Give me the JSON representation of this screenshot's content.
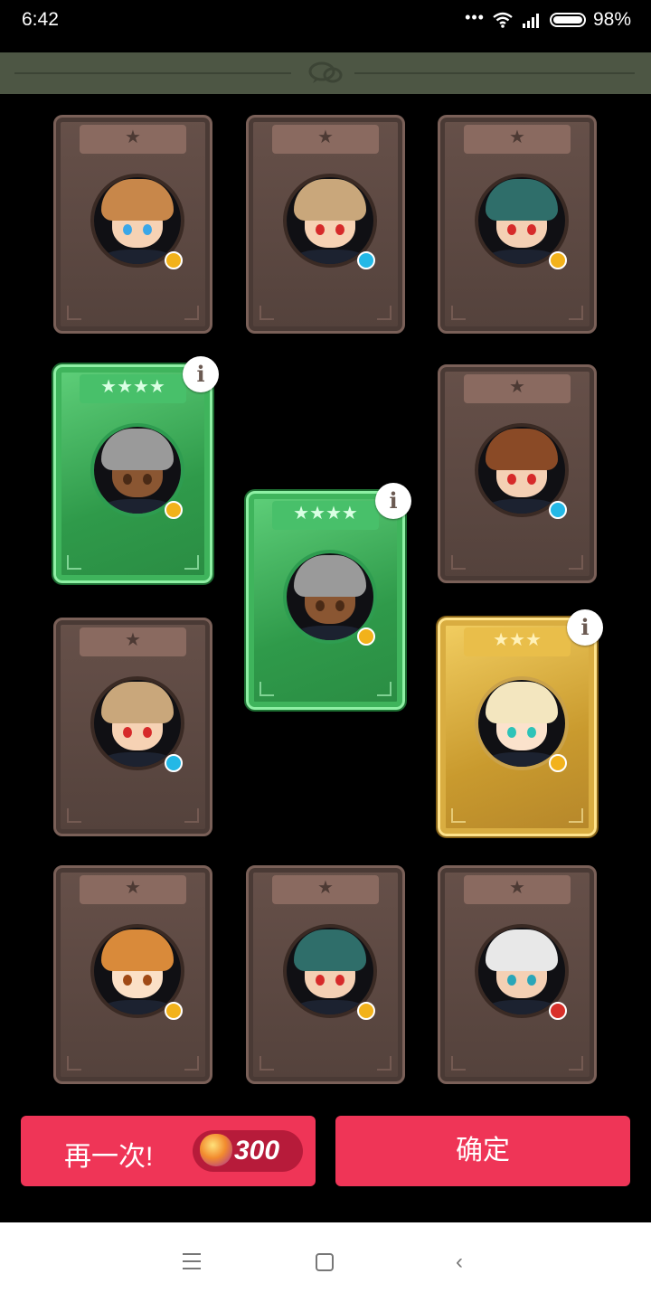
{
  "status_bar": {
    "time": "6:42",
    "signal_dots": "•••",
    "battery_percent": "98%"
  },
  "cards": [
    {
      "row": 1,
      "col": 1,
      "rarity": "common",
      "stars": "★",
      "hair": "#c8874a",
      "skin": "#f6d2b4",
      "eye": "#3aa7e8",
      "type": "hand",
      "type_color": "#f2b21b",
      "info": false
    },
    {
      "row": 1,
      "col": 2,
      "rarity": "common",
      "stars": "★",
      "hair": "#c9a77b",
      "skin": "#f6d2b4",
      "eye": "#d62a2a",
      "type": "bubble",
      "type_color": "#23b8e6",
      "info": false
    },
    {
      "row": 1,
      "col": 3,
      "rarity": "common",
      "stars": "★",
      "hair": "#2f6e6a",
      "skin": "#f4d0b4",
      "eye": "#d62a2a",
      "type": "hand",
      "type_color": "#f2b21b",
      "info": false
    },
    {
      "row": 2,
      "col": 1,
      "rarity": "epic",
      "stars": "★★★★",
      "hair": "#9a9a9a",
      "skin": "#8a5632",
      "eye": "#4a2a16",
      "type": "hand",
      "type_color": "#f2b21b",
      "info": true,
      "info_label": "i"
    },
    {
      "row": 2,
      "col": 3,
      "rarity": "common",
      "stars": "★",
      "hair": "#8a4a26",
      "skin": "#f4d0b4",
      "eye": "#d62a2a",
      "type": "bubble",
      "type_color": "#23b8e6",
      "info": false
    },
    {
      "row": 2.5,
      "col": 2,
      "rarity": "epic",
      "stars": "★★★★",
      "hair": "#9a9a9a",
      "skin": "#8a5632",
      "eye": "#4a2a16",
      "type": "hand",
      "type_color": "#f2b21b",
      "info": true,
      "info_label": "i"
    },
    {
      "row": 3,
      "col": 1,
      "rarity": "common",
      "stars": "★",
      "hair": "#c9a77b",
      "skin": "#f6d2b4",
      "eye": "#d62a2a",
      "type": "bubble",
      "type_color": "#23b8e6",
      "info": false
    },
    {
      "row": 3,
      "col": 3,
      "rarity": "rare",
      "stars": "★★★",
      "hair": "#f3e6bf",
      "skin": "#fbe2cc",
      "eye": "#2ec3b8",
      "type": "hand",
      "type_color": "#f2b21b",
      "info": true,
      "info_label": "i"
    },
    {
      "row": 4,
      "col": 1,
      "rarity": "common",
      "stars": "★",
      "hair": "#d98a3a",
      "skin": "#fbe0c6",
      "eye": "#a04a16",
      "type": "hand",
      "type_color": "#f2b21b",
      "info": false
    },
    {
      "row": 4,
      "col": 2,
      "rarity": "common",
      "stars": "★",
      "hair": "#2f6e6a",
      "skin": "#f4d0b4",
      "eye": "#d62a2a",
      "type": "hand",
      "type_color": "#f2b21b",
      "info": false
    },
    {
      "row": 4,
      "col": 3,
      "rarity": "common",
      "stars": "★",
      "hair": "#e8e8e8",
      "skin": "#f4d0b4",
      "eye": "#2aa6b8",
      "type": "rabbit",
      "type_color": "#d8302a",
      "info": false
    }
  ],
  "buttons": {
    "again_label": "再一次!",
    "again_cost": "300",
    "again_currency_icon": "gem-icon",
    "confirm_label": "确定"
  },
  "colors": {
    "button": "#ef3557",
    "cost_pill": "#b71b3a",
    "background": "#000000"
  }
}
